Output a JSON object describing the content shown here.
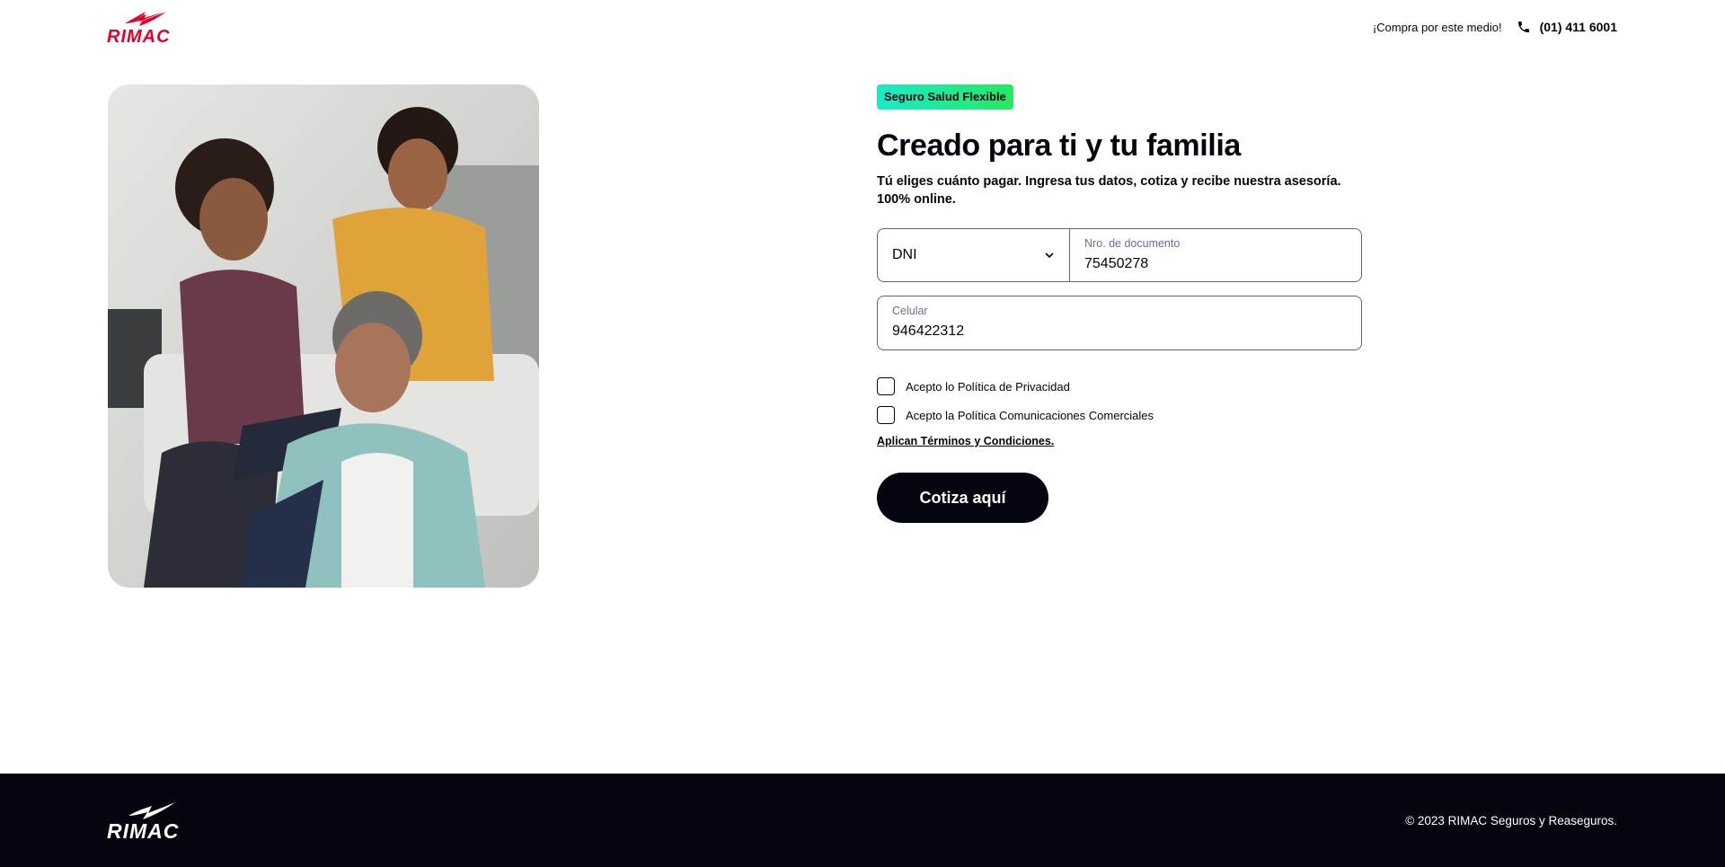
{
  "brand": {
    "name": "RIMAC",
    "primary_color": "#e4002b",
    "dark_color": "#03050f",
    "badge_gradient": [
      "#1de9c8",
      "#27e85f"
    ]
  },
  "header": {
    "buy_text": "¡Compra por este medio!",
    "phone_icon": "phone-icon",
    "phone_number": "(01) 411 6001"
  },
  "hero": {
    "image_description_icon": "family-photo"
  },
  "form": {
    "badge": "Seguro Salud Flexible",
    "title": "Creado para ti y tu familia",
    "subtitle": "Tú eliges cuánto pagar. Ingresa tus datos, cotiza y recibe nuestra asesoría. 100% online.",
    "document_type": {
      "selected": "DNI",
      "icon": "chevron-down-icon"
    },
    "document_number": {
      "label": "Nro. de documento",
      "value": "75450278"
    },
    "cellphone": {
      "label": "Celular",
      "value": "946422312"
    },
    "checkboxes": [
      {
        "label": "Acepto lo Política de Privacidad",
        "checked": false
      },
      {
        "label": "Acepto la Política Comunicaciones Comerciales",
        "checked": false
      }
    ],
    "terms_link": "Aplican Términos y Condiciones.",
    "submit_label": "Cotiza aquí"
  },
  "footer": {
    "copyright": "© 2023 RIMAC Seguros y Reaseguros."
  }
}
